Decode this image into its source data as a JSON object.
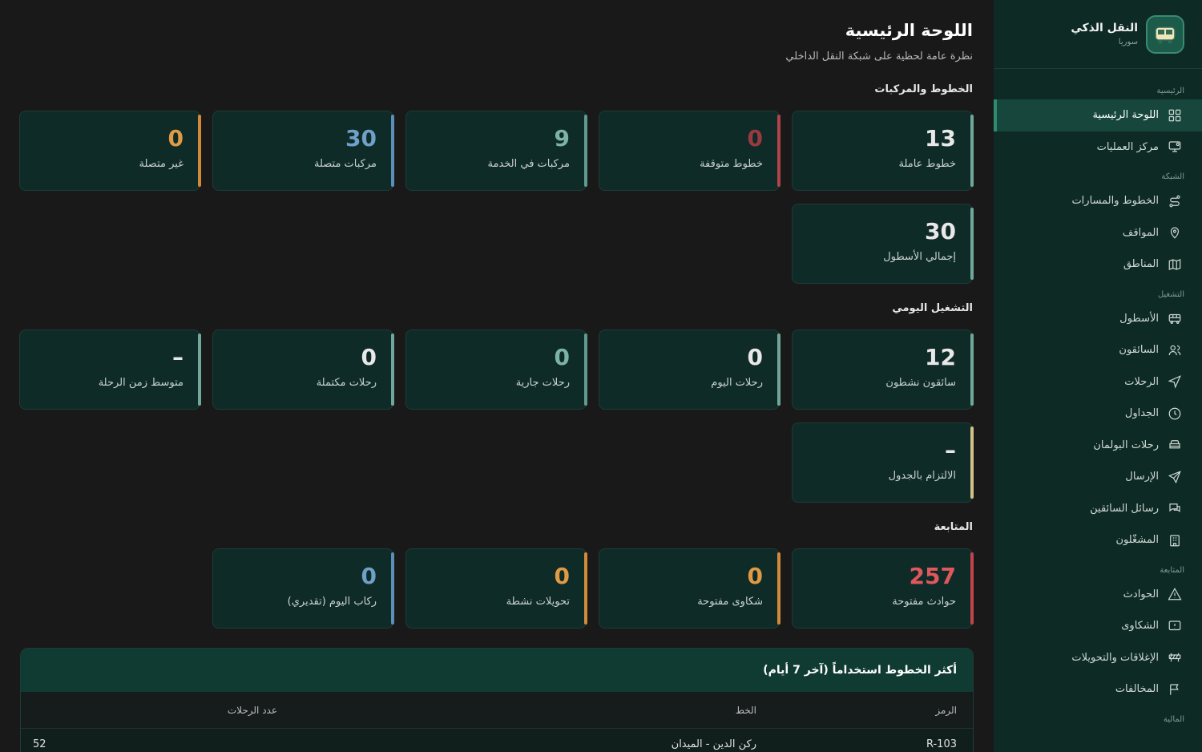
{
  "brand": {
    "title": "النقل الذكي",
    "subtitle": "سوريا"
  },
  "sidebar": {
    "sections": [
      {
        "title": "الرئيسية",
        "items": [
          {
            "label": "اللوحة الرئيسية",
            "icon": "grid-icon",
            "active": true
          },
          {
            "label": "مركز العمليات",
            "icon": "monitor-icon"
          }
        ]
      },
      {
        "title": "الشبكة",
        "items": [
          {
            "label": "الخطوط والمسارات",
            "icon": "route-icon"
          },
          {
            "label": "المواقف",
            "icon": "map-pin-icon"
          },
          {
            "label": "المناطق",
            "icon": "map-icon"
          }
        ]
      },
      {
        "title": "التشغيل",
        "items": [
          {
            "label": "الأسطول",
            "icon": "bus-icon"
          },
          {
            "label": "السائقون",
            "icon": "users-icon"
          },
          {
            "label": "الرحلات",
            "icon": "navigation-icon"
          },
          {
            "label": "الجداول",
            "icon": "clock-icon"
          },
          {
            "label": "رحلات البولمان",
            "icon": "coach-icon"
          },
          {
            "label": "الإرسال",
            "icon": "send-icon"
          },
          {
            "label": "رسائل السائقين",
            "icon": "chat-icon"
          },
          {
            "label": "المشغّلون",
            "icon": "building-icon"
          }
        ]
      },
      {
        "title": "المتابعة",
        "items": [
          {
            "label": "الحوادث",
            "icon": "alert-triangle-icon"
          },
          {
            "label": "الشكاوى",
            "icon": "message-alert-icon"
          },
          {
            "label": "الإغلاقات والتحويلات",
            "icon": "barrier-icon"
          },
          {
            "label": "المخالفات",
            "icon": "flag-icon"
          }
        ]
      },
      {
        "title": "المالية",
        "items": []
      }
    ]
  },
  "header": {
    "title": "اللوحة الرئيسية",
    "subtitle": "نظرة عامة لحظية على شبكة النقل الداخلي"
  },
  "sections": {
    "lines": "الخطوط والمركبات",
    "daily": "التشغيل اليومي",
    "monitoring": "المتابعة"
  },
  "cards": {
    "lines": [
      {
        "value": "13",
        "label": "خطوط عاملة",
        "accent": "#6fa89a",
        "valcolor": "#e8e8e8"
      },
      {
        "value": "0",
        "label": "خطوط متوقفة",
        "accent": "#b0444a",
        "valcolor": "#9a3a40"
      },
      {
        "value": "9",
        "label": "مركبات في الخدمة",
        "accent": "#5e9a90",
        "valcolor": "#7cb3a8"
      },
      {
        "value": "30",
        "label": "مركبات متصلة",
        "accent": "#5b8fb8",
        "valcolor": "#6fa0c8"
      },
      {
        "value": "0",
        "label": "غير متصلة",
        "accent": "#d08a3a",
        "valcolor": "#e09a45"
      },
      {
        "value": "30",
        "label": "إجمالي الأسطول",
        "accent": "#6fa89a",
        "valcolor": "#e8e8e8"
      }
    ],
    "daily": [
      {
        "value": "12",
        "label": "سائقون نشطون",
        "accent": "#6fa89a",
        "valcolor": "#e8e8e8"
      },
      {
        "value": "0",
        "label": "رحلات اليوم",
        "accent": "#6fa89a",
        "valcolor": "#e8e8e8"
      },
      {
        "value": "0",
        "label": "رحلات جارية",
        "accent": "#5e9a90",
        "valcolor": "#7cb3a8"
      },
      {
        "value": "0",
        "label": "رحلات مكتملة",
        "accent": "#6fa89a",
        "valcolor": "#e8e8e8"
      },
      {
        "value": "–",
        "label": "متوسط زمن الرحلة",
        "accent": "#6fa89a",
        "valcolor": "#e8e8e8"
      },
      {
        "value": "–",
        "label": "الالتزام بالجدول",
        "accent": "#d4c08a",
        "valcolor": "#e8e8e8"
      }
    ],
    "monitoring": [
      {
        "value": "257",
        "label": "حوادث مفتوحة",
        "accent": "#c0444a",
        "valcolor": "#e0575c"
      },
      {
        "value": "0",
        "label": "شكاوى مفتوحة",
        "accent": "#d08a3a",
        "valcolor": "#e09a45"
      },
      {
        "value": "0",
        "label": "تحويلات نشطة",
        "accent": "#d08a3a",
        "valcolor": "#e09a45"
      },
      {
        "value": "0",
        "label": "ركاب اليوم (تقديري)",
        "accent": "#5b8fb8",
        "valcolor": "#6fa0c8"
      }
    ]
  },
  "table": {
    "title": "أكثر الخطوط استخداماً (آخر 7 أيام)",
    "columns": {
      "code": "الرمز",
      "line": "الخط",
      "count": "عدد الرحلات"
    },
    "rows": [
      {
        "code": "R-103",
        "line": "ركن الدين - الميدان",
        "count": "52"
      }
    ]
  }
}
